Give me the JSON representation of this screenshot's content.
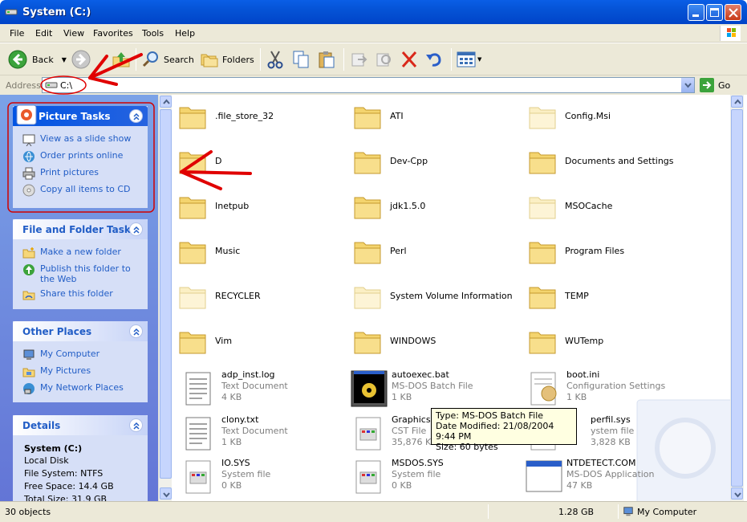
{
  "window": {
    "title": "System (C:)"
  },
  "menu": [
    "File",
    "Edit",
    "View",
    "Favorites",
    "Tools",
    "Help"
  ],
  "toolbar": {
    "back": "Back",
    "search": "Search",
    "folders": "Folders"
  },
  "address": {
    "label": "Address",
    "value": "C:\\",
    "go": "Go"
  },
  "panels": {
    "picture_tasks": {
      "title": "Picture Tasks",
      "items": [
        "View as a slide show",
        "Order prints online",
        "Print pictures",
        "Copy all items to CD"
      ]
    },
    "file_folder_tasks": {
      "title": "File and Folder Tasks",
      "items": [
        "Make a new folder",
        "Publish this folder to the Web",
        "Share this folder"
      ]
    },
    "other_places": {
      "title": "Other Places",
      "items": [
        "My Computer",
        "My Pictures",
        "My Network Places"
      ]
    },
    "details": {
      "title": "Details",
      "name": "System (C:)",
      "type": "Local Disk",
      "filesystem": "File System: NTFS",
      "free": "Free Space: 14.4 GB",
      "total": "Total Size: 31.9 GB"
    }
  },
  "folders": [
    ".file_store_32",
    "ATI",
    "Config.Msi",
    "D",
    "Dev-Cpp",
    "Documents and Settings",
    "Inetpub",
    "jdk1.5.0",
    "MSOCache",
    "Music",
    "Perl",
    "Program Files",
    "RECYCLER",
    "System Volume Information",
    "TEMP",
    "Vim",
    "WINDOWS",
    "WUTemp"
  ],
  "files": [
    {
      "name": "adp_inst.log",
      "type": "Text Document",
      "size": "4 KB"
    },
    {
      "name": "autoexec.bat",
      "type": "MS-DOS Batch File",
      "size": "1 KB"
    },
    {
      "name": "boot.ini",
      "type": "Configuration Settings",
      "size": "1 KB"
    },
    {
      "name": "clony.txt",
      "type": "Text Document",
      "size": "1 KB"
    },
    {
      "name": "Graphics.c",
      "type": "CST File",
      "size": "35,876 K"
    },
    {
      "name": "perfil.sys",
      "type": "ystem file",
      "size": "3,828 KB"
    },
    {
      "name": "IO.SYS",
      "type": "System file",
      "size": "0 KB"
    },
    {
      "name": "MSDOS.SYS",
      "type": "System file",
      "size": "0 KB"
    },
    {
      "name": "NTDETECT.COM",
      "type": "MS-DOS Application",
      "size": "47 KB"
    }
  ],
  "tooltip": {
    "line1": "Type: MS-DOS Batch File",
    "line2": "Date Modified: 21/08/2004 9:44 PM",
    "line3": "Size: 60 bytes"
  },
  "status": {
    "objects": "30 objects",
    "size": "1.28 GB",
    "location": "My Computer"
  },
  "colors": {
    "xp_blue": "#0054e3",
    "link_blue": "#215dc6",
    "annotation_red": "#e00000"
  }
}
